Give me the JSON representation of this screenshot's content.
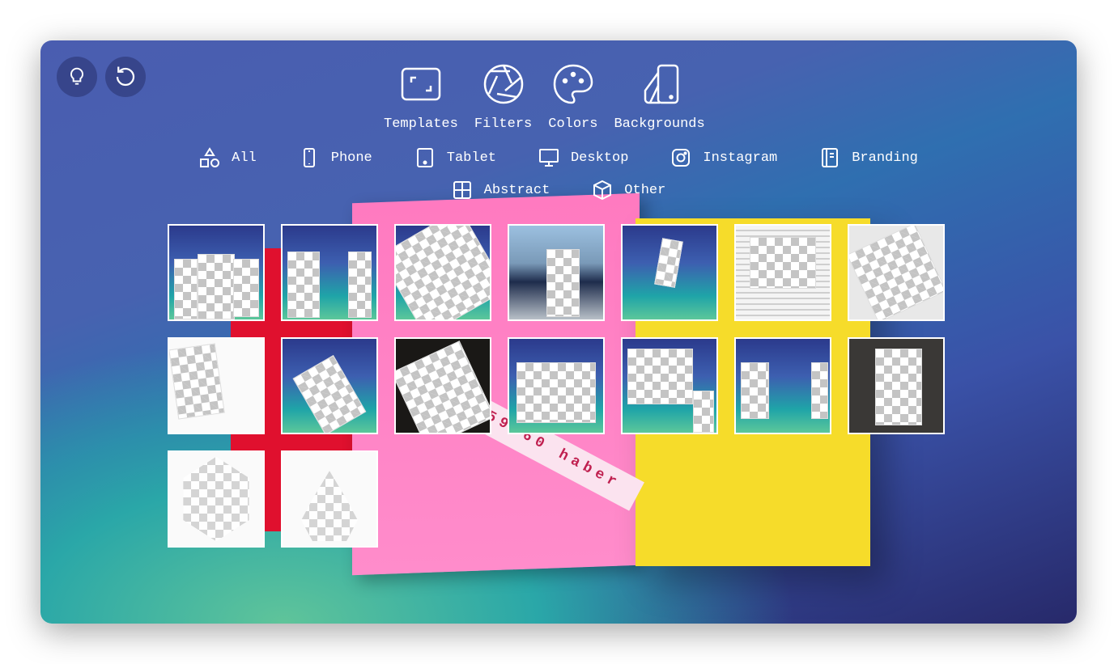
{
  "top_buttons": [
    {
      "icon": "lightbulb-icon"
    },
    {
      "icon": "undo-icon"
    }
  ],
  "tools": [
    {
      "label": "Templates",
      "icon": "templates-icon"
    },
    {
      "label": "Filters",
      "icon": "aperture-icon"
    },
    {
      "label": "Colors",
      "icon": "palette-icon"
    },
    {
      "label": "Backgrounds",
      "icon": "backgrounds-icon"
    }
  ],
  "categories_row1": [
    {
      "label": "All",
      "icon": "shapes-icon"
    },
    {
      "label": "Phone",
      "icon": "phone-icon"
    },
    {
      "label": "Tablet",
      "icon": "tablet-icon"
    },
    {
      "label": "Desktop",
      "icon": "desktop-icon"
    },
    {
      "label": "Instagram",
      "icon": "instagram-icon"
    },
    {
      "label": "Branding",
      "icon": "notebook-icon"
    }
  ],
  "categories_row2": [
    {
      "label": "Abstract",
      "icon": "grid-icon"
    },
    {
      "label": "Other",
      "icon": "cube-icon"
    }
  ],
  "background_art": {
    "tape_text": "59 60 haber",
    "colors": {
      "red": "#e0102e",
      "pink": "#ff7ac0",
      "yellow": "#f6dc2a"
    }
  },
  "templates": [
    {
      "bg": "gradient",
      "shape": "three-cards"
    },
    {
      "bg": "gradient",
      "shape": "two-cards"
    },
    {
      "bg": "gradient",
      "shape": "tilted-sheet"
    },
    {
      "bg": "city",
      "shape": "poster"
    },
    {
      "bg": "gradient",
      "shape": "hand-card"
    },
    {
      "bg": "office",
      "shape": "imac"
    },
    {
      "bg": "light",
      "shape": "stationery"
    },
    {
      "bg": "white",
      "shape": "laptop"
    },
    {
      "bg": "gradient",
      "shape": "phone"
    },
    {
      "bg": "dark",
      "shape": "tablet-tilted"
    },
    {
      "bg": "gradient",
      "shape": "person-sign"
    },
    {
      "bg": "gradient",
      "shape": "imac-ipad"
    },
    {
      "bg": "gradient",
      "shape": "ipad-case"
    },
    {
      "bg": "desk",
      "shape": "paper"
    },
    {
      "bg": "white",
      "shape": "hexagon"
    },
    {
      "bg": "white",
      "shape": "drop"
    }
  ]
}
